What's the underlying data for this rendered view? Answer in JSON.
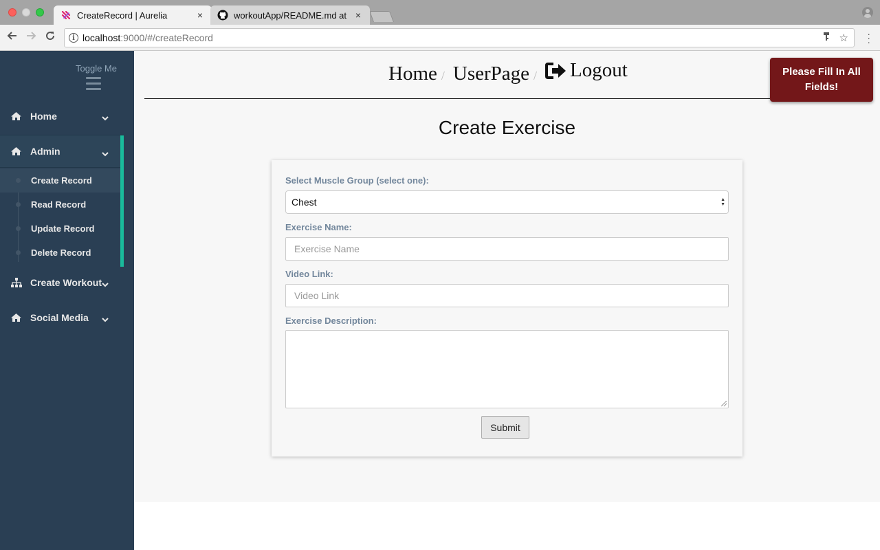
{
  "browser": {
    "tabs": [
      {
        "title": "CreateRecord | Aurelia",
        "close": "×"
      },
      {
        "title": "workoutApp/README.md at m",
        "close": "×"
      }
    ],
    "url_host": "localhost",
    "url_rest": ":9000/#/createRecord",
    "icons": [
      "back-icon",
      "forward-icon",
      "reload-icon",
      "info-icon",
      "key-icon",
      "star-icon",
      "menu-icon",
      "profile-icon"
    ]
  },
  "sidebar": {
    "toggle_label": "Toggle Me",
    "items": [
      {
        "label": "Home",
        "icon": "home-icon"
      },
      {
        "label": "Admin",
        "icon": "home-icon"
      },
      {
        "label": "Create Workout",
        "icon": "sitemap-icon"
      },
      {
        "label": "Social Media",
        "icon": "home-icon"
      }
    ],
    "admin_sub": [
      {
        "label": "Create Record",
        "active": true
      },
      {
        "label": "Read Record"
      },
      {
        "label": "Update Record"
      },
      {
        "label": "Delete Record"
      }
    ]
  },
  "header": {
    "crumbs": [
      "Home",
      "UserPage",
      "Logout"
    ],
    "separator": "/"
  },
  "toast": {
    "message": "Please Fill In All Fields!",
    "color": "#731719"
  },
  "form": {
    "title": "Create Exercise",
    "muscle_label": "Select Muscle Group (select one):",
    "muscle_value": "Chest",
    "name_label": "Exercise Name:",
    "name_placeholder": "Exercise Name",
    "video_label": "Video Link:",
    "video_placeholder": "Video Link",
    "desc_label": "Exercise Description:",
    "submit_label": "Submit"
  },
  "colors": {
    "sidebar_bg": "#2a3f54",
    "accent": "#1abb9c",
    "label": "#73879c"
  }
}
